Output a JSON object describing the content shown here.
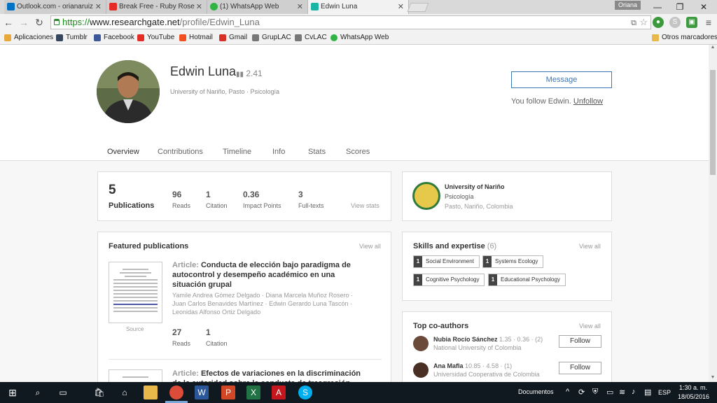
{
  "browser": {
    "tabs": [
      {
        "label": "Outlook.com - orianaruiz",
        "color": "#0072c6"
      },
      {
        "label": "Break Free - Ruby Rose",
        "color": "#e52d27"
      },
      {
        "label": "(1) WhatsApp Web",
        "color": "#2fb344"
      },
      {
        "label": "Edwin Luna",
        "color": "#1bb5a6"
      }
    ],
    "user_badge": "Oriana",
    "url": {
      "scheme": "https://",
      "host": "www.researchgate.net",
      "path": "/profile/Edwin_Luna"
    },
    "bookmarks": [
      {
        "label": "Aplicaciones",
        "color": "#e9a83b"
      },
      {
        "label": "Tumblr",
        "color": "#35465c"
      },
      {
        "label": "Facebook",
        "color": "#3b5998"
      },
      {
        "label": "YouTube",
        "color": "#e52d27"
      },
      {
        "label": "Hotmail",
        "color": "#f25022"
      },
      {
        "label": "Gmail",
        "color": "#d93025"
      },
      {
        "label": "GrupLAC",
        "color": "#777777"
      },
      {
        "label": "CvLAC",
        "color": "#777777"
      },
      {
        "label": "WhatsApp Web",
        "color": "#2fb344"
      }
    ],
    "other_bookmarks": "Otros marcadores"
  },
  "profile": {
    "name": "Edwin Luna",
    "rg_score": "2.41",
    "affiliation": "University of Nariño, Pasto · Psicología",
    "message_label": "Message",
    "follow_text": "You follow Edwin.",
    "unfollow_label": "Unfollow"
  },
  "nav": {
    "tabs": [
      "Overview",
      "Contributions",
      "Timeline",
      "Info",
      "Stats",
      "Scores"
    ]
  },
  "stats": {
    "publications_count": "5",
    "publications_label": "Publications",
    "items": [
      {
        "value": "96",
        "label": "Reads"
      },
      {
        "value": "1",
        "label": "Citation"
      },
      {
        "value": "0.36",
        "label": "Impact Points"
      },
      {
        "value": "3",
        "label": "Full-texts"
      }
    ],
    "view_stats": "View stats"
  },
  "institution": {
    "name": "University of Nariño",
    "department": "Psicología",
    "location": "Pasto, Nariño, Colombia"
  },
  "featured": {
    "title": "Featured publications",
    "view_all": "View all",
    "pub1": {
      "type": "Article:",
      "title": "Conducta de elección bajo paradigma de autocontrol y desempeño académico en una situación grupal",
      "authors": "Yamile Andrea Gómez Delgado · Diana Marcela Muñoz Rosero · Juan Carlos Benavides Martínez · Edwin Gerardo Luna Tascón · Leonidas Alfonso Ortiz Delgado",
      "source_label": "Source",
      "reads_value": "27",
      "reads_label": "Reads",
      "citation_value": "1",
      "citation_label": "Citation"
    },
    "pub2": {
      "type": "Article:",
      "title": "Efectos de variaciones en la discriminación de la autoridad sobre la conducta de trasgresión"
    }
  },
  "skills": {
    "title": "Skills and expertise",
    "count": "(6)",
    "view_all": "View all",
    "items": [
      {
        "count": "1",
        "label": "Social Environment"
      },
      {
        "count": "1",
        "label": "Systems Ecology"
      },
      {
        "count": "1",
        "label": "Cognitive Psychology"
      },
      {
        "count": "1",
        "label": "Educational Psychology"
      }
    ]
  },
  "coauthors": {
    "title": "Top co-authors",
    "view_all": "View all",
    "items": [
      {
        "name": "Nubia Rocío Sánchez",
        "metrics": "1.35 · 0.36 · (2)",
        "institution": "National University of Colombia",
        "follow": "Follow"
      },
      {
        "name": "Ana Mafla",
        "metrics": "10.85 · 4.58 · (1)",
        "institution": "Universidad Cooperativa de Colombia",
        "follow": "Follow"
      }
    ]
  },
  "taskbar": {
    "documents_label": "Documentos",
    "language": "ESP",
    "time": "1:30 a. m.",
    "date": "18/05/2016"
  }
}
